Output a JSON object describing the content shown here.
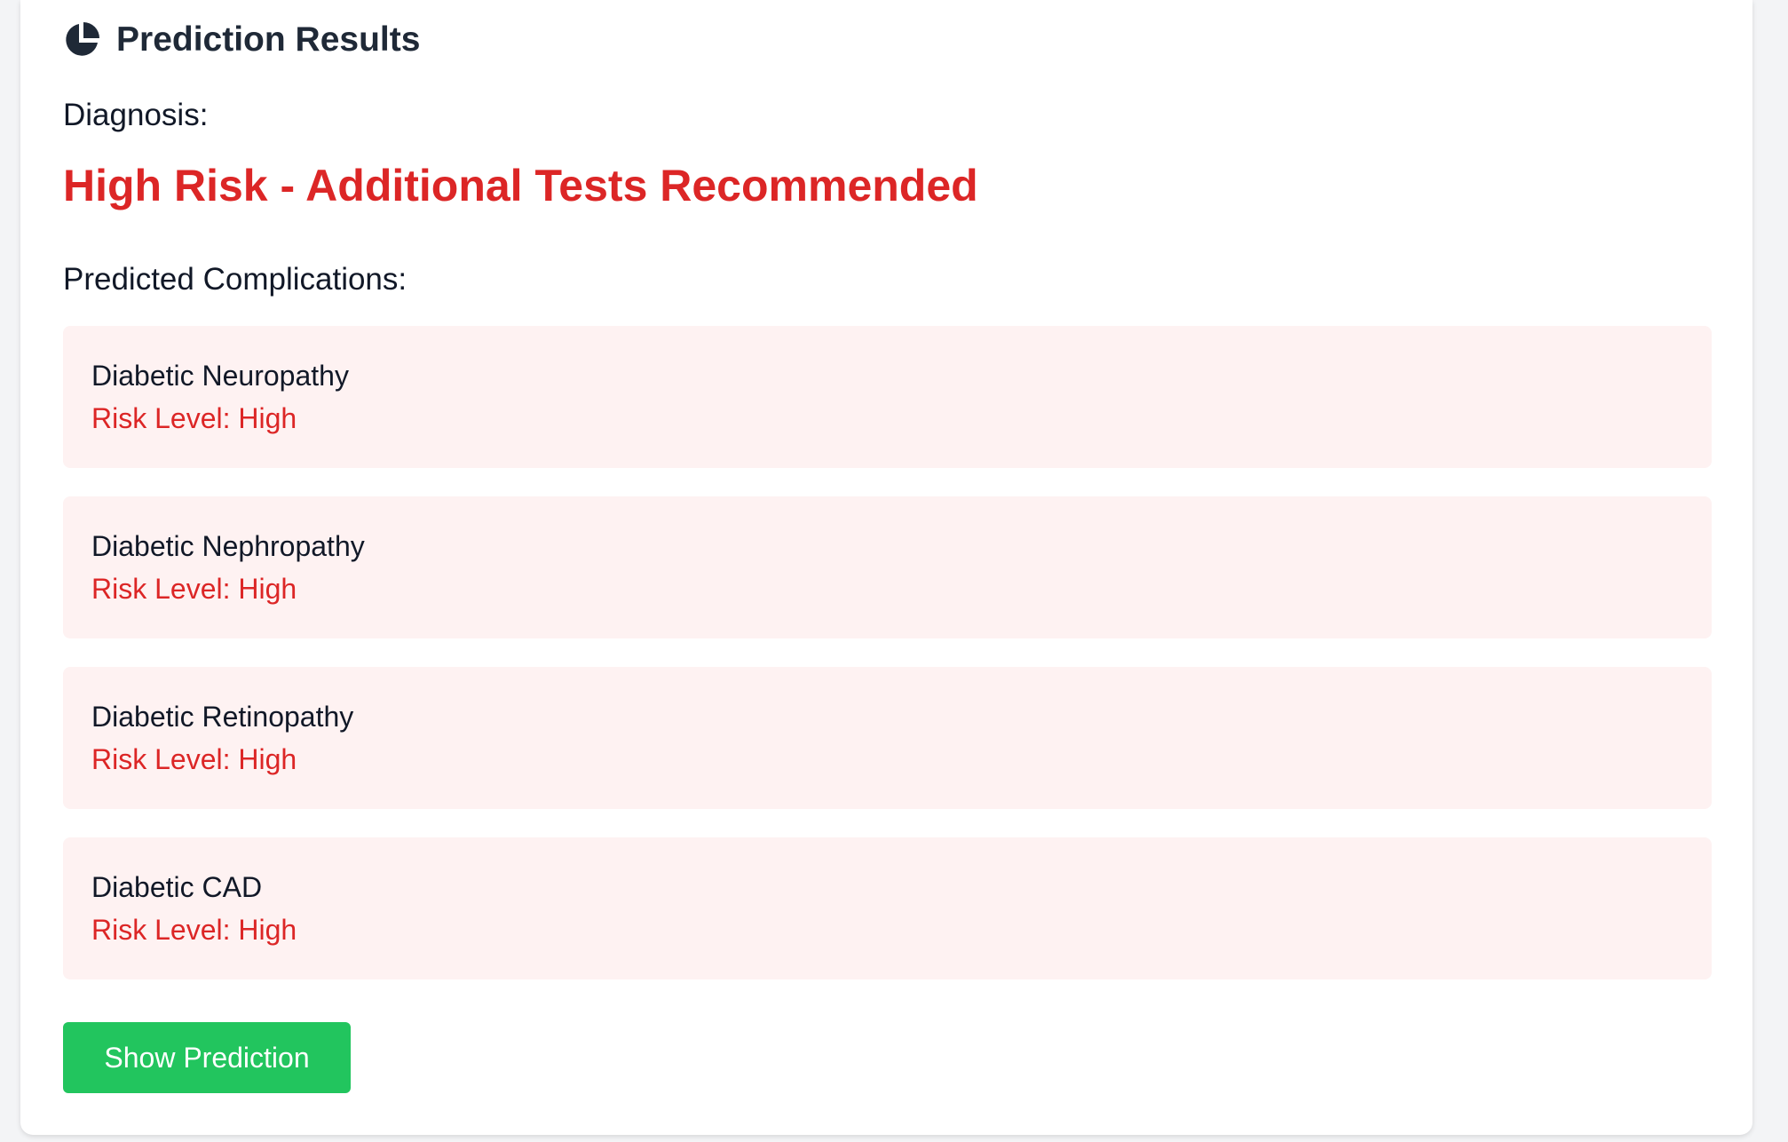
{
  "results": {
    "title": "Prediction Results",
    "title_icon": "pie-chart-icon",
    "diagnosis_label": "Diagnosis:",
    "diagnosis_value": "High Risk - Additional Tests Recommended",
    "complications_label": "Predicted Complications:",
    "complications": [
      {
        "name": "Diabetic Neuropathy",
        "risk": "Risk Level: High"
      },
      {
        "name": "Diabetic Nephropathy",
        "risk": "Risk Level: High"
      },
      {
        "name": "Diabetic Retinopathy",
        "risk": "Risk Level: High"
      },
      {
        "name": "Diabetic CAD",
        "risk": "Risk Level: High"
      }
    ],
    "button_label": "Show Prediction"
  },
  "colors": {
    "danger": "#dc2626",
    "danger_bg": "#fef2f2",
    "success": "#22c55e",
    "heading": "#1f2937"
  }
}
